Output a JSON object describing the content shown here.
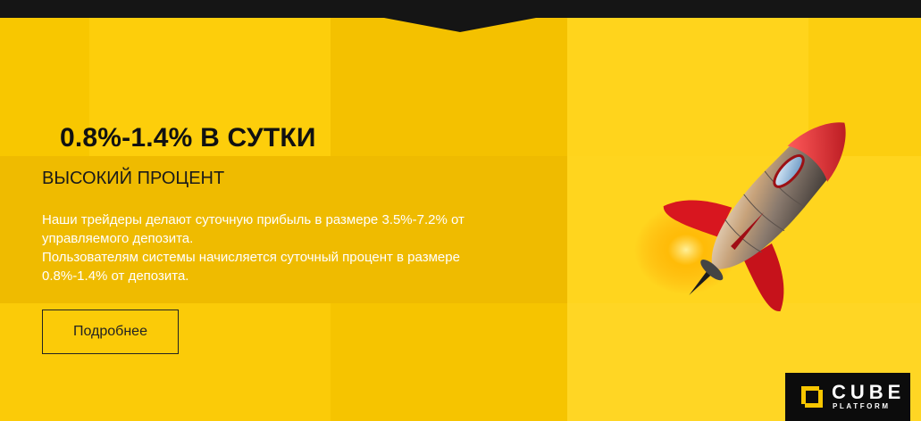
{
  "hero": {
    "headline": "0.8%-1.4% В СУТКИ",
    "subheadline": "ВЫСОКИЙ ПРОЦЕНТ",
    "description": [
      "Наши трейдеры делают суточную прибыль в размере 3.5%-7.2% от управляемого депозита.",
      "Пользователям системы начисляется суточный процент в размере 0.8%-1.4% от депозита."
    ],
    "more_button_label": "Подробнее"
  },
  "logo": {
    "name": "CUBE",
    "tagline": "PLATFORM"
  },
  "decoration": {
    "image": "rocket-illustration",
    "mark_icon": "corner-bracket-icon"
  },
  "colors": {
    "background": "#f6c400",
    "tile_light": "#ffd31a",
    "tile_dark": "#f0bd00",
    "top_bar": "#151515",
    "text_dark": "#111111",
    "text_light": "#ffffff",
    "logo_accent": "#f7c600",
    "rocket_red": "#d4141e"
  }
}
